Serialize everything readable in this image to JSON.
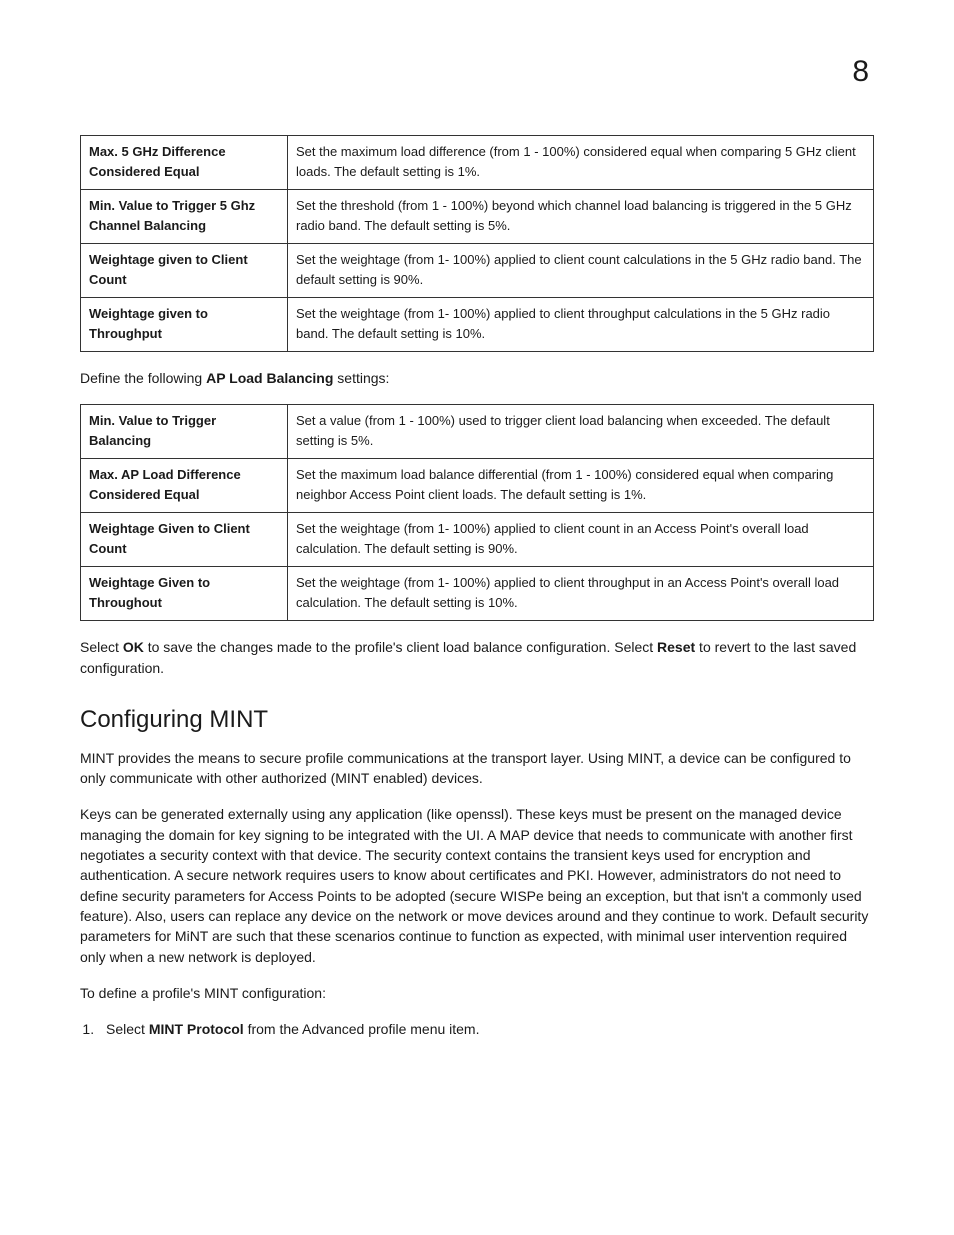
{
  "pageNumber": "8",
  "table1": {
    "rows": [
      {
        "label": "Max. 5 GHz Difference Considered Equal",
        "value": "Set the maximum load difference (from 1 - 100%) considered equal when comparing 5 GHz client loads. The default setting is 1%."
      },
      {
        "label": "Min. Value to Trigger 5 Ghz Channel Balancing",
        "value": "Set the threshold (from 1 - 100%) beyond which channel load balancing is triggered in the 5 GHz radio band. The default setting is 5%."
      },
      {
        "label": "Weightage given to Client Count",
        "value": "Set the weightage (from 1- 100%) applied to client count calculations in the 5 GHz radio band. The default setting is 90%."
      },
      {
        "label": "Weightage given to Throughput",
        "value": "Set the weightage (from 1- 100%) applied to client throughput calculations in the 5 GHz radio band. The default setting is 10%."
      }
    ]
  },
  "midText": {
    "prefix": "Define the following ",
    "bold": "AP Load Balancing",
    "suffix": " settings:"
  },
  "table2": {
    "rows": [
      {
        "label": "Min. Value to Trigger Balancing",
        "value": "Set a value (from 1 - 100%) used to trigger client load balancing when exceeded. The default setting is 5%."
      },
      {
        "label": "Max. AP Load Difference Considered Equal",
        "value": "Set the maximum load balance differential (from 1 - 100%) considered equal when comparing neighbor Access Point client loads. The default setting is 1%."
      },
      {
        "label": "Weightage Given to Client Count",
        "value": "Set the weightage (from 1- 100%) applied to client count in an Access Point's overall load calculation. The default setting is 90%."
      },
      {
        "label": "Weightage Given to Throughout",
        "value": "Set the weightage (from 1- 100%) applied to client throughput in an Access Point's overall load calculation. The default setting is 10%."
      }
    ]
  },
  "okResetText": {
    "p1_a": "Select ",
    "p1_b": "OK",
    "p1_c": " to save the changes made to the profile's client load balance configuration. Select ",
    "p1_d": "Reset",
    "p1_e": " to revert to the last saved configuration."
  },
  "sectionTitle": "Configuring MINT",
  "mintPara1": "MINT provides the means to secure profile communications at the transport layer. Using MINT, a device can be configured to only communicate with other authorized (MINT enabled) devices.",
  "mintPara2": "Keys can be generated externally using any application (like openssl). These keys must be present on the managed device managing the domain for key signing to be integrated with the UI. A MAP device that needs to communicate with another first negotiates a security context with that device. The security context contains the transient keys used for encryption and authentication. A secure network requires users to know about certificates and PKI. However, administrators do not need to define security parameters for Access Points to be adopted (secure WISPe being an exception, but that isn't a commonly used feature). Also, users can replace any device on the network or move devices around and they continue to work. Default security parameters for MiNT are such that these scenarios continue to function as expected, with minimal user intervention required only when a new network is deployed.",
  "mintPara3": "To define a profile's MINT configuration:",
  "step1": {
    "a": "Select ",
    "b": "MINT Protocol",
    "c": " from the Advanced profile menu item."
  }
}
